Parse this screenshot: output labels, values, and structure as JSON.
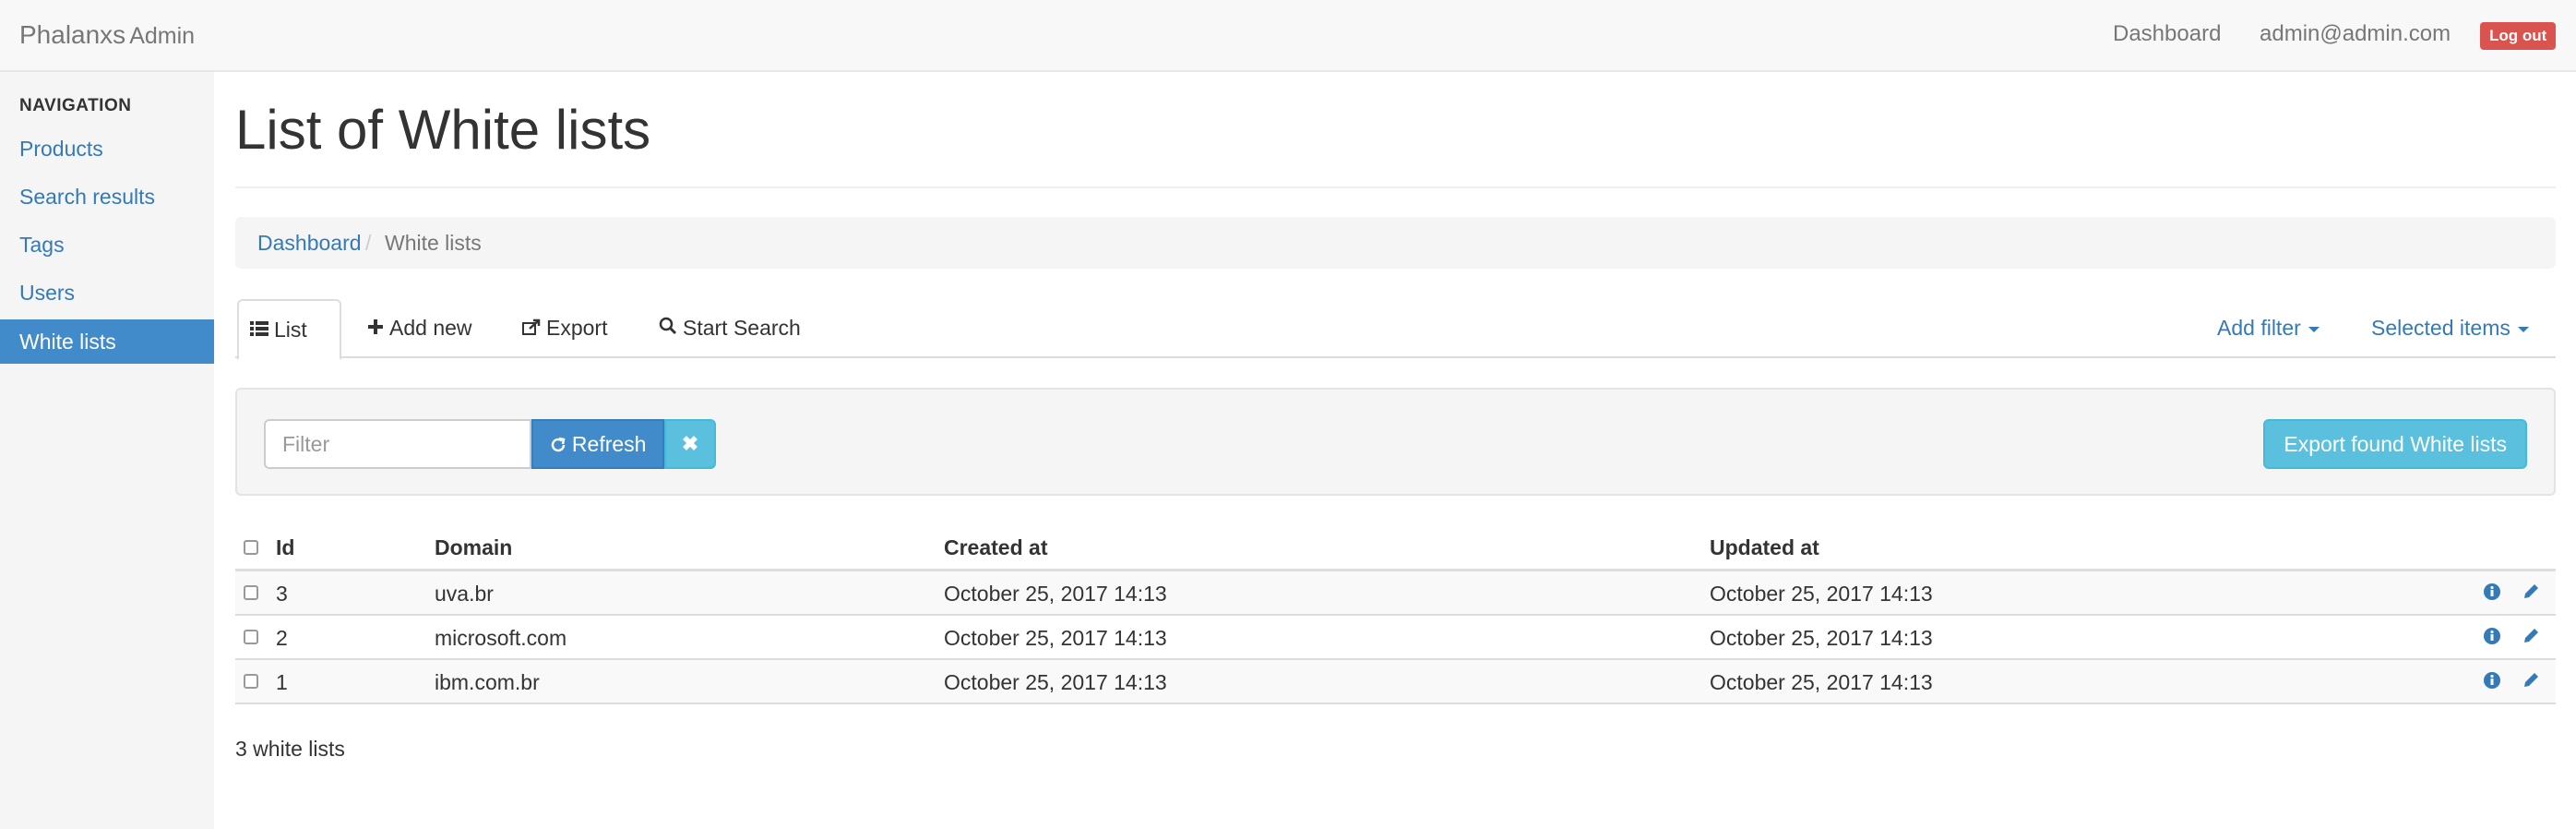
{
  "header": {
    "brand": "Phalanxs",
    "brand_sub": "Admin",
    "dashboard_link": "Dashboard",
    "user_email": "admin@admin.com",
    "logout_label": "Log out"
  },
  "sidebar": {
    "heading": "NAVIGATION",
    "items": [
      {
        "label": "Products"
      },
      {
        "label": "Search results"
      },
      {
        "label": "Tags"
      },
      {
        "label": "Users"
      },
      {
        "label": "White lists",
        "active": true
      }
    ]
  },
  "main": {
    "title": "List of White lists",
    "breadcrumb": {
      "root": "Dashboard",
      "separator": "/",
      "current": "White lists"
    },
    "tabs": {
      "list": "List",
      "add_new": "Add new",
      "export": "Export",
      "start_search": "Start Search",
      "add_filter": "Add filter",
      "selected_items": "Selected items"
    },
    "filter": {
      "placeholder": "Filter",
      "refresh_label": "Refresh",
      "export_label": "Export found White lists"
    },
    "table": {
      "columns": [
        "Id",
        "Domain",
        "Created at",
        "Updated at"
      ],
      "rows": [
        {
          "id": "3",
          "domain": "uva.br",
          "created_at": "October 25, 2017 14:13",
          "updated_at": "October 25, 2017 14:13"
        },
        {
          "id": "2",
          "domain": "microsoft.com",
          "created_at": "October 25, 2017 14:13",
          "updated_at": "October 25, 2017 14:13"
        },
        {
          "id": "1",
          "domain": "ibm.com.br",
          "created_at": "October 25, 2017 14:13",
          "updated_at": "October 25, 2017 14:13"
        }
      ]
    },
    "total_label": "3 white lists"
  },
  "colors": {
    "link": "#337ab7",
    "active_nav": "#428bca",
    "danger": "#d9534f",
    "info": "#5bc0de"
  }
}
